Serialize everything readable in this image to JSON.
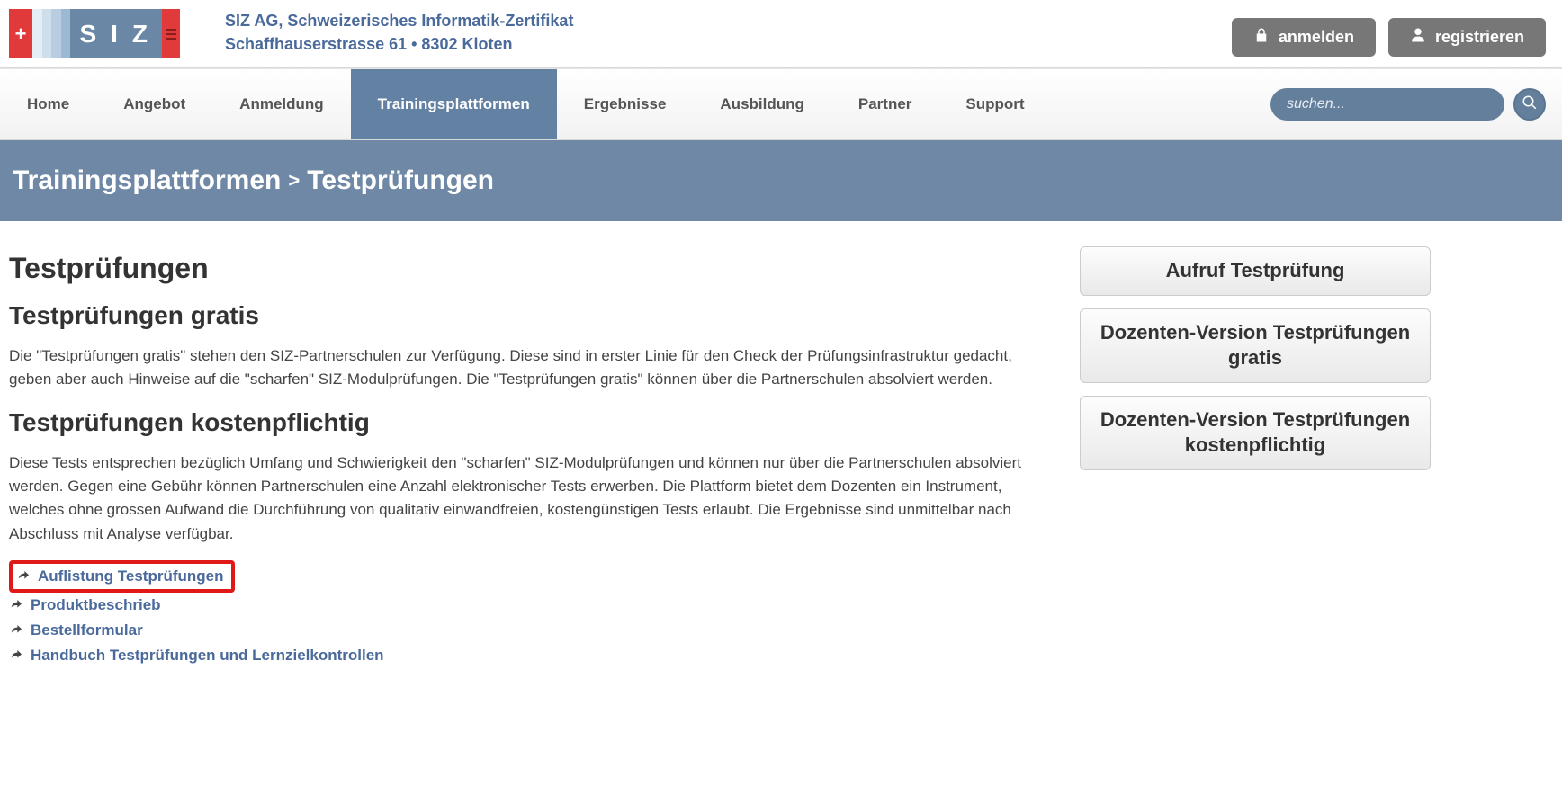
{
  "header": {
    "company_name": "SIZ AG, Schweizerisches Informatik-Zertifikat",
    "company_address": "Schaffhauserstrasse 61 •  8302 Kloten",
    "login_label": "anmelden",
    "register_label": "registrieren",
    "logo_text": "SIZ"
  },
  "nav": {
    "items": [
      {
        "label": "Home"
      },
      {
        "label": "Angebot"
      },
      {
        "label": "Anmeldung"
      },
      {
        "label": "Trainingsplattformen",
        "active": true
      },
      {
        "label": "Ergebnisse"
      },
      {
        "label": "Ausbildung"
      },
      {
        "label": "Partner"
      },
      {
        "label": "Support"
      }
    ],
    "search_placeholder": "suchen..."
  },
  "banner": {
    "crumb1": "Trainingsplattformen",
    "sep": ">",
    "crumb2": "Testprüfungen"
  },
  "main": {
    "title": "Testprüfungen",
    "sec1_title": "Testprüfungen gratis",
    "sec1_body": "Die \"Testprüfungen gratis\" stehen den SIZ-Partnerschulen zur Verfügung. Diese sind in erster Linie für den Check der Prüfungsinfrastruktur gedacht, geben aber auch Hinweise auf die \"scharfen\" SIZ-Modulprüfungen. Die \"Testprüfungen gratis\" können über die Partnerschulen absolviert werden.",
    "sec2_title": "Testprüfungen kostenpflichtig",
    "sec2_body": "Diese Tests entsprechen bezüglich Umfang und Schwierigkeit den \"scharfen\" SIZ-Modulprüfungen und können nur über die Partnerschulen absolviert werden. Gegen eine Gebühr können Partnerschulen eine Anzahl elektronischer Tests erwerben. Die Plattform bietet dem Dozenten ein Instrument, welches ohne grossen Aufwand die Durchführung von qualitativ einwandfreien, kostengünstigen Tests erlaubt. Die Ergebnisse sind unmittelbar nach Abschluss mit Analyse verfügbar.",
    "links": [
      {
        "label": "Auflistung Testprüfungen",
        "highlight": true
      },
      {
        "label": "Produktbeschrieb"
      },
      {
        "label": "Bestellformular"
      },
      {
        "label": "Handbuch Testprüfungen und Lernzielkontrollen"
      }
    ]
  },
  "sidebar": {
    "items": [
      {
        "label": "Aufruf Testprüfung"
      },
      {
        "label": "Dozenten-Version Testprüfungen gratis"
      },
      {
        "label": "Dozenten-Version Testprüfungen kostenpflichtig"
      }
    ]
  }
}
